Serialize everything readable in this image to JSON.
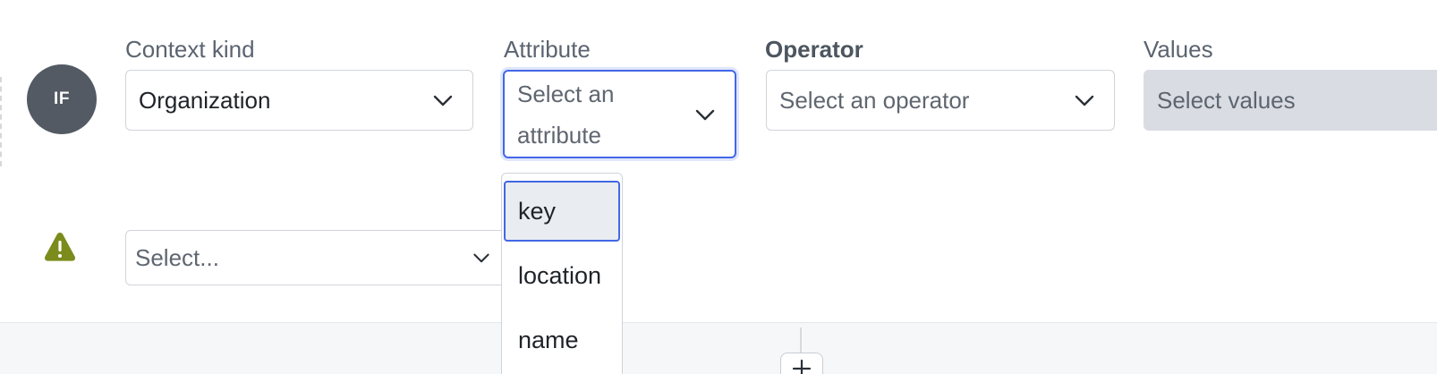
{
  "condition": {
    "badge": "IF",
    "context_kind": {
      "label": "Context kind",
      "value": "Organization"
    },
    "attribute": {
      "label": "Attribute",
      "placeholder": "Select an attribute",
      "options": [
        "key",
        "location",
        "name"
      ],
      "highlighted": "key"
    },
    "operator": {
      "label": "Operator",
      "placeholder": "Select an operator"
    },
    "values": {
      "label": "Values",
      "placeholder": "Select values"
    }
  },
  "second_row": {
    "select_placeholder": "Select..."
  },
  "colors": {
    "accent": "#4367e6",
    "badge": "#535a63",
    "warning": "#7b8c1d"
  },
  "icons": {
    "chevron": "chevron-down-icon",
    "warning": "warning-triangle-icon",
    "add": "plus-icon"
  }
}
